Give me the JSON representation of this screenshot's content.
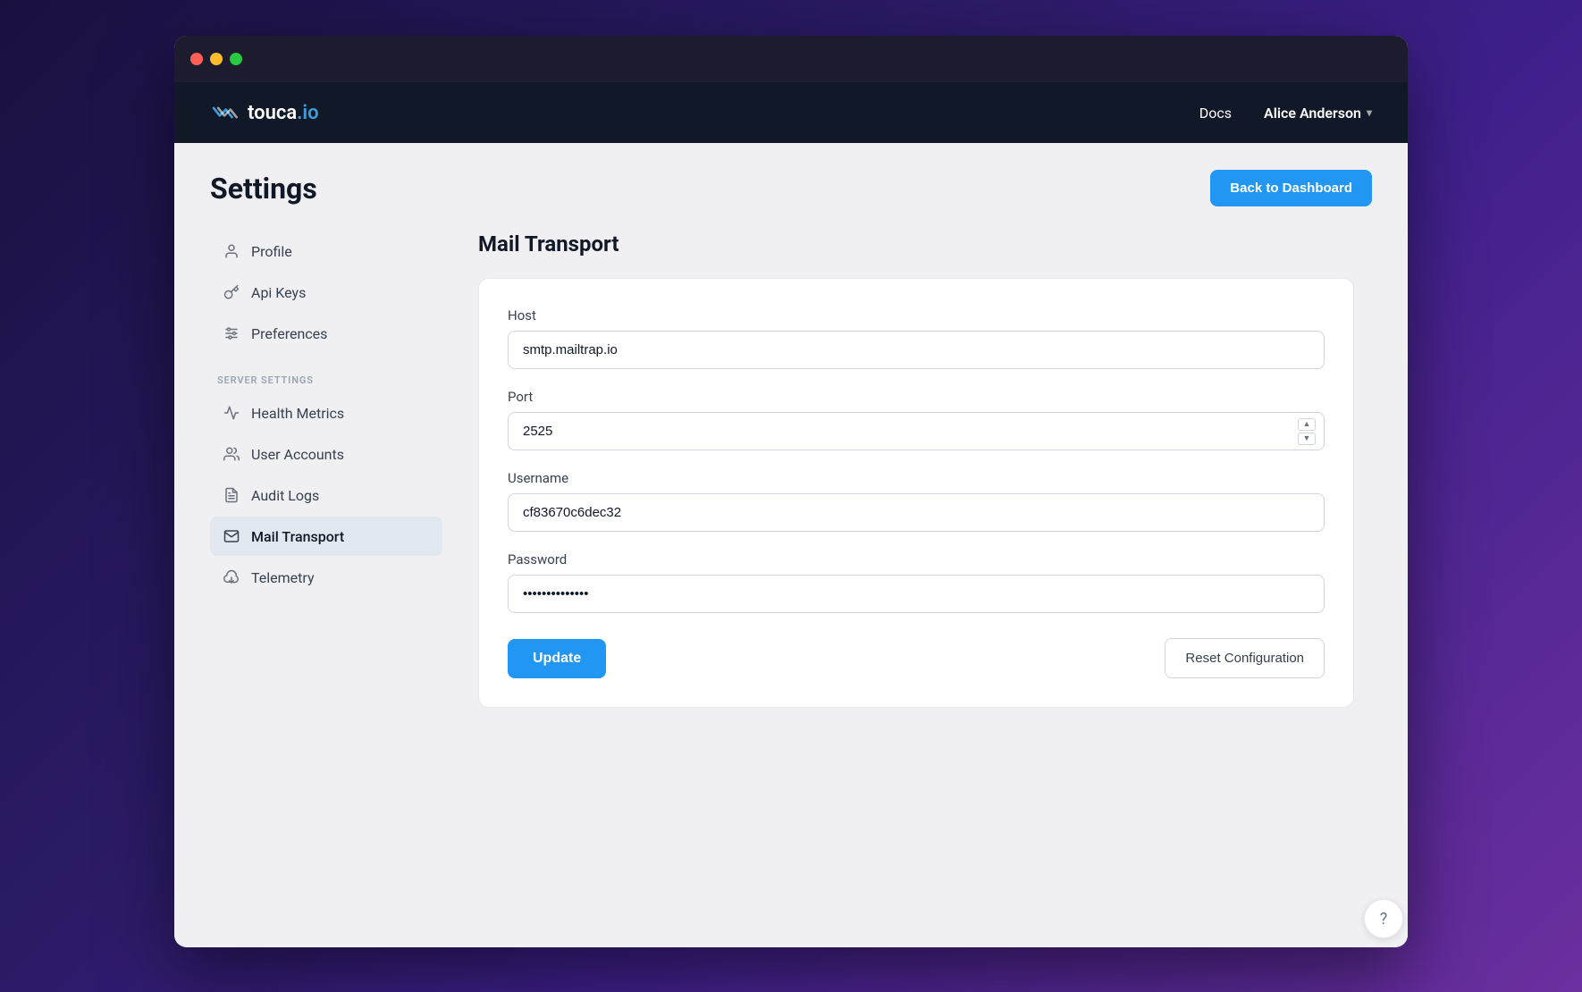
{
  "window": {
    "title": "touca.io Settings"
  },
  "navbar": {
    "brand": "touca.io",
    "brand_touca": "touca",
    "brand_io": ".io",
    "docs_label": "Docs",
    "user_label": "Alice Anderson"
  },
  "settings": {
    "page_title": "Settings",
    "back_button_label": "Back to Dashboard"
  },
  "sidebar": {
    "user_items": [
      {
        "id": "profile",
        "label": "Profile",
        "icon": "user-icon"
      },
      {
        "id": "api-keys",
        "label": "Api Keys",
        "icon": "key-icon"
      },
      {
        "id": "preferences",
        "label": "Preferences",
        "icon": "sliders-icon"
      }
    ],
    "server_section_label": "SERVER SETTINGS",
    "server_items": [
      {
        "id": "health-metrics",
        "label": "Health Metrics",
        "icon": "activity-icon"
      },
      {
        "id": "user-accounts",
        "label": "User Accounts",
        "icon": "users-icon"
      },
      {
        "id": "audit-logs",
        "label": "Audit Logs",
        "icon": "file-text-icon"
      },
      {
        "id": "mail-transport",
        "label": "Mail Transport",
        "icon": "mail-icon",
        "active": true
      },
      {
        "id": "telemetry",
        "label": "Telemetry",
        "icon": "cloud-icon"
      }
    ]
  },
  "mail_transport": {
    "panel_title": "Mail Transport",
    "host_label": "Host",
    "host_value": "smtp.mailtrap.io",
    "port_label": "Port",
    "port_value": "2525",
    "username_label": "Username",
    "username_value": "cf83670c6dec32",
    "password_label": "Password",
    "password_value": "••••••••••••••",
    "update_button_label": "Update",
    "reset_button_label": "Reset Configuration"
  },
  "help": {
    "label": "?"
  }
}
